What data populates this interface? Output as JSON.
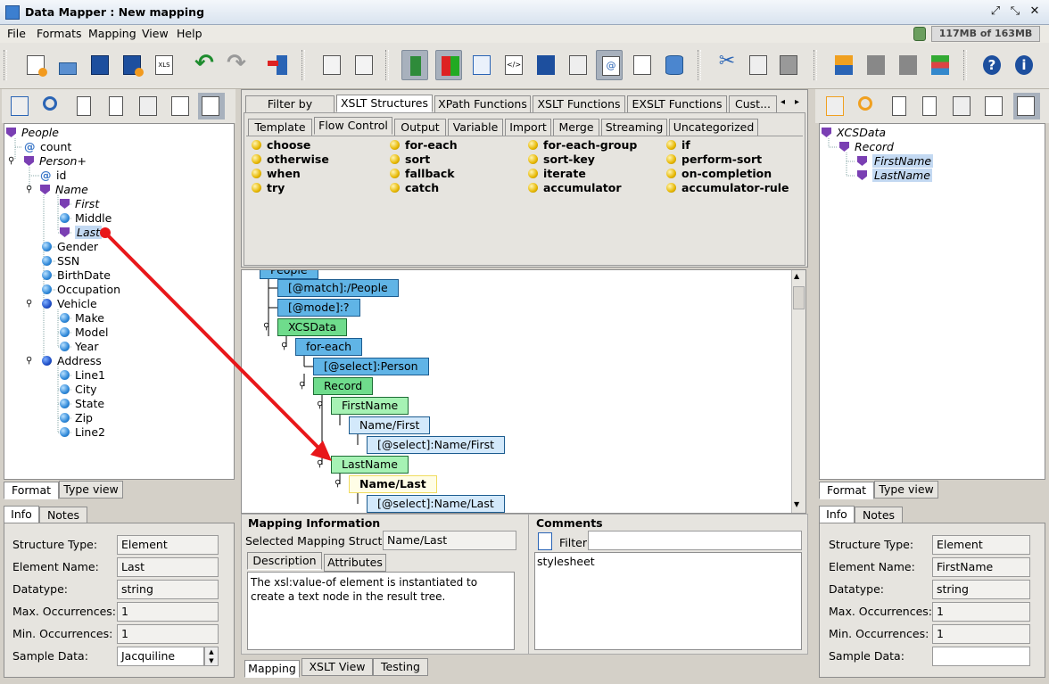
{
  "window": {
    "title": "Data Mapper : New mapping"
  },
  "menu": [
    "File",
    "Formats",
    "Mapping",
    "View",
    "Help"
  ],
  "memory": "117MB of 163MB",
  "left_tree": [
    {
      "label": "People",
      "icon": "element-icon",
      "italic": true
    },
    {
      "label": "count",
      "icon": "attribute-icon"
    },
    {
      "label": "Person+",
      "icon": "element-icon",
      "italic": true
    },
    {
      "label": "id",
      "icon": "attribute-icon"
    },
    {
      "label": "Name",
      "icon": "element-icon",
      "italic": true
    },
    {
      "label": "First",
      "icon": "element-icon",
      "italic": true
    },
    {
      "label": "Middle",
      "icon": "field-icon"
    },
    {
      "label": "Last",
      "icon": "element-icon",
      "italic": true,
      "selected": true
    },
    {
      "label": "Gender",
      "icon": "field-icon"
    },
    {
      "label": "SSN",
      "icon": "field-icon"
    },
    {
      "label": "BirthDate",
      "icon": "field-icon"
    },
    {
      "label": "Occupation",
      "icon": "field-icon"
    },
    {
      "label": "Vehicle",
      "icon": "group-icon"
    },
    {
      "label": "Make",
      "icon": "field-icon"
    },
    {
      "label": "Model",
      "icon": "field-icon"
    },
    {
      "label": "Year",
      "icon": "field-icon"
    },
    {
      "label": "Address",
      "icon": "group-icon"
    },
    {
      "label": "Line1",
      "icon": "field-icon"
    },
    {
      "label": "City",
      "icon": "field-icon"
    },
    {
      "label": "State",
      "icon": "field-icon"
    },
    {
      "label": "Zip",
      "icon": "field-icon"
    },
    {
      "label": "Line2",
      "icon": "field-icon"
    }
  ],
  "left_view_tabs": [
    "Format",
    "Type view"
  ],
  "left_info_tabs": [
    "Info",
    "Notes"
  ],
  "left_info": {
    "labels": [
      "Structure Type:",
      "Element Name:",
      "Datatype:",
      "Max. Occurrences:",
      "Min. Occurrences:",
      "Sample Data:"
    ],
    "values": [
      "Element",
      "Last",
      "string",
      "1",
      "1",
      "Jacquiline"
    ]
  },
  "palette_tabs": [
    "Filter by pattern",
    "XSLT Structures",
    "XPath Functions",
    "XSLT Functions",
    "EXSLT Functions",
    "Cust..."
  ],
  "sub_tabs": [
    "Template",
    "Flow Control",
    "Output",
    "Variable",
    "Import",
    "Merge",
    "Streaming",
    "Uncategorized"
  ],
  "flow_items": [
    [
      "choose",
      "for-each",
      "for-each-group",
      "if"
    ],
    [
      "otherwise",
      "sort",
      "sort-key",
      "perform-sort"
    ],
    [
      "when",
      "fallback",
      "iterate",
      "on-completion"
    ],
    [
      "try",
      "catch",
      "accumulator",
      "accumulator-rule"
    ]
  ],
  "mapping_nodes": [
    "People",
    "[@match]:/People",
    "[@mode]:?",
    "XCSData",
    "for-each",
    "[@select]:Person",
    "Record",
    "FirstName",
    "Name/First",
    "[@select]:Name/First",
    "LastName",
    "Name/Last",
    "[@select]:Name/Last"
  ],
  "mapping_info": {
    "title": "Mapping Information",
    "selected_label": "Selected Mapping Structure:",
    "selected_value": "Name/Last",
    "tabs": [
      "Description",
      "Attributes"
    ],
    "description": "The xsl:value-of element is instantiated to create a text node in the result tree."
  },
  "comments": {
    "title": "Comments",
    "filter_label": "Filter:",
    "items": [
      "stylesheet"
    ]
  },
  "bottom_tabs": [
    "Mapping",
    "XSLT View",
    "Testing"
  ],
  "right_tree": [
    {
      "label": "XCSData",
      "icon": "element-icon",
      "italic": true
    },
    {
      "label": "Record",
      "icon": "element-icon",
      "italic": true
    },
    {
      "label": "FirstName",
      "icon": "element-icon",
      "italic": true,
      "selected": true
    },
    {
      "label": "LastName",
      "icon": "element-icon",
      "italic": true,
      "selected": true
    }
  ],
  "right_view_tabs": [
    "Format",
    "Type view"
  ],
  "right_info_tabs": [
    "Info",
    "Notes"
  ],
  "right_info": {
    "labels": [
      "Structure Type:",
      "Element Name:",
      "Datatype:",
      "Max. Occurrences:",
      "Min. Occurrences:",
      "Sample Data:"
    ],
    "values": [
      "Element",
      "FirstName",
      "string",
      "1",
      "1",
      ""
    ]
  },
  "colors": {
    "accent_arrow": "#e8171a",
    "node_blue": "#60b4e6",
    "node_green": "#6fdc8c",
    "selection": "#c3d9f2"
  }
}
